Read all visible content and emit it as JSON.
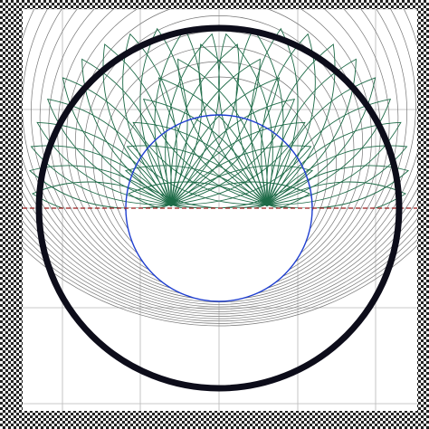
{
  "figure": {
    "frame_pattern": "checkerboard",
    "colors": {
      "background": "#ffffff",
      "frame_dark": "#222222",
      "frame_light": "#f2f2f2",
      "outer_ring": "#0d0d1a",
      "inner_circle": "#1f3fd0",
      "envelope_circles": "#777777",
      "grid": "#b8b8b8",
      "family_curves": "#1d6a47",
      "midline": "#9b1b1b"
    },
    "family_curve_count": 40,
    "envelope_circle_count": 22,
    "focal_points": 2,
    "midline_style": "dashed",
    "inner_circle_fill_below_midline": "#ffffff"
  }
}
